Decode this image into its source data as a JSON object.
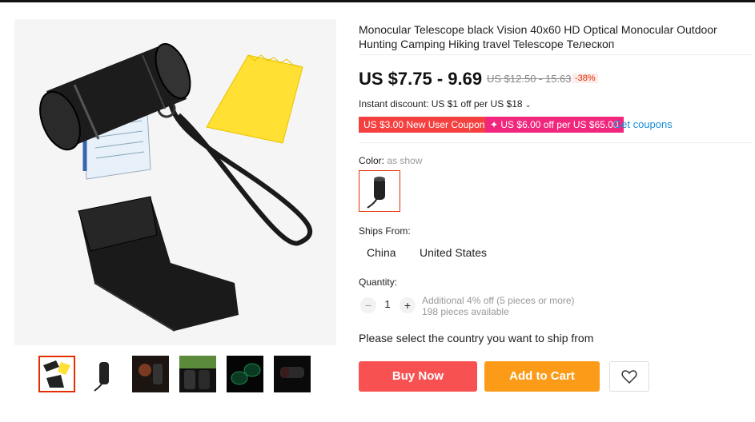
{
  "product": {
    "title": "Monocular Telescope black Vision 40x60 HD Optical Monocular Outdoor Hunting Camping Hiking travel Telescope Телескоп"
  },
  "pricing": {
    "current": "US $7.75 - 9.69",
    "original": "US $12.50 - 15.63",
    "discount": "-38%"
  },
  "instant_discount": "Instant discount: US $1 off per US $18",
  "coupons": [
    {
      "label": "US $3.00 New User Coupon"
    },
    {
      "label": "✦ US $6.00 off per US $65.00"
    }
  ],
  "get_coupons": "Get coupons",
  "color": {
    "label": "Color:",
    "value": "as show"
  },
  "ships_from": {
    "label": "Ships From:",
    "options": [
      "China",
      "United States"
    ]
  },
  "quantity": {
    "label": "Quantity:",
    "minus": "−",
    "plus": "+",
    "value": "1",
    "additional": "Additional 4% off (5 pieces or more)",
    "available": "198 pieces available"
  },
  "select_country_msg": "Please select the country you want to ship from",
  "actions": {
    "buy_now": "Buy Now",
    "add_to_cart": "Add to Cart",
    "wishlist_icon": "heart-icon"
  },
  "colors": {
    "accent": "#e62e04",
    "buy": "#f85151",
    "cart": "#fb9b17",
    "link": "#1a8cd8"
  }
}
